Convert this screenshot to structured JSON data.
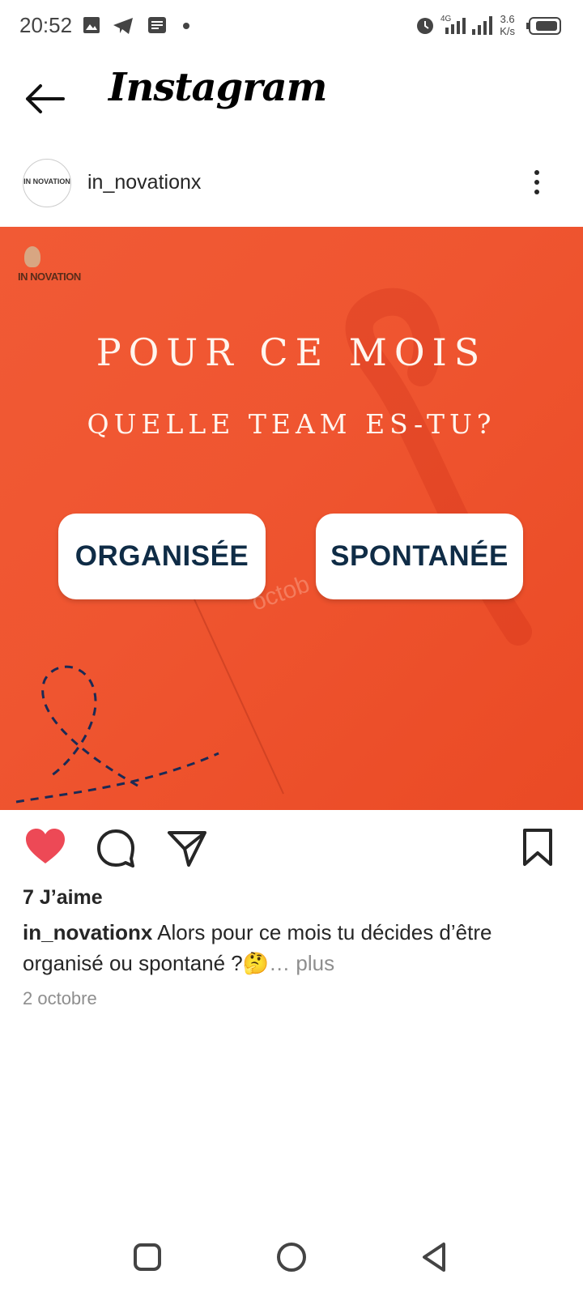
{
  "status_bar": {
    "time": "20:52",
    "net_speed_value": "3.6",
    "net_speed_unit": "K/s",
    "icons": [
      "gallery-icon",
      "telegram-icon",
      "message-icon",
      "dot-icon",
      "alarm-icon",
      "signal-4g-icon",
      "signal-icon",
      "battery-icon"
    ]
  },
  "header": {
    "title": "Instagram"
  },
  "post": {
    "username": "in_novationx",
    "avatar_text": "IN NOVATION",
    "image": {
      "brand": "IN NOVATION",
      "headline1": "POUR CE MOIS",
      "headline2": "QUELLE TEAM ES-TU?",
      "option_left": "ORGANISÉE",
      "option_right": "SPONTANÉE",
      "background_word": "octob",
      "colors": {
        "background": "#ef5530",
        "button_text": "#0f2c46"
      }
    },
    "likes": "7 J’aime",
    "caption_user": "in_novationx",
    "caption_text": " Alors pour ce mois tu décides d’être organisé ou spontané ?🤔",
    "caption_more": "… plus",
    "date": "2 octobre",
    "liked": true,
    "colors": {
      "like": "#ed4956"
    }
  }
}
